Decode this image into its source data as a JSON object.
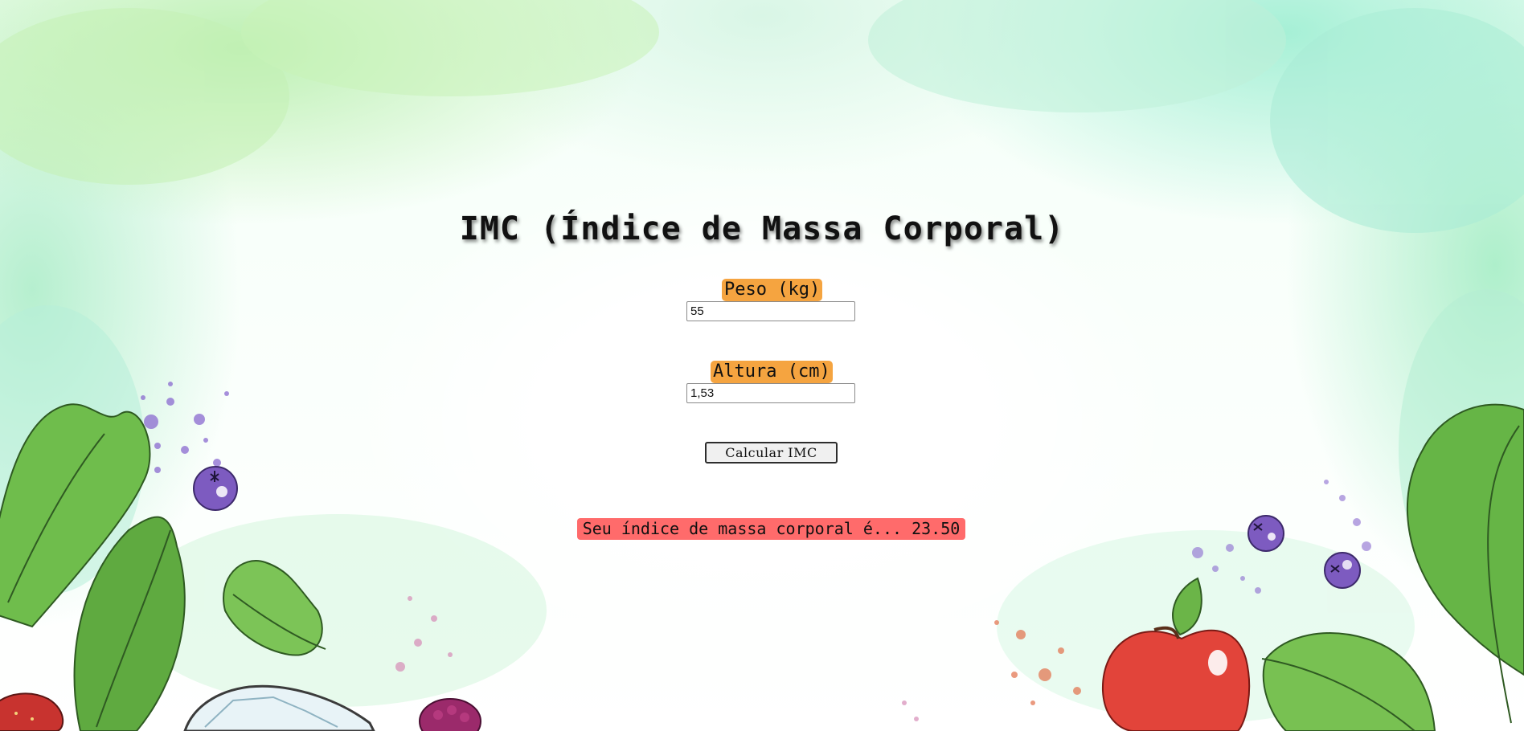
{
  "page": {
    "title": "IMC (Índice de Massa Corporal)"
  },
  "form": {
    "weight": {
      "label": "Peso (kg)",
      "value": "55"
    },
    "height": {
      "label": "Altura (cm)",
      "value": "1,53"
    },
    "submit_label": "Calcular IMC"
  },
  "result": {
    "text": "Seu índice de massa corporal é... 23.50"
  },
  "colors": {
    "label_background": "#f5a440",
    "result_background": "#ff6b6b",
    "leaf_green": "#5fae3f",
    "blueberry_purple": "#7d5bc0",
    "apple_red": "#e2443a"
  },
  "decorations": {
    "icons": [
      "leaf-icon",
      "blueberry-icon",
      "apple-icon",
      "raspberry-icon",
      "paint-splatter-icon"
    ]
  }
}
